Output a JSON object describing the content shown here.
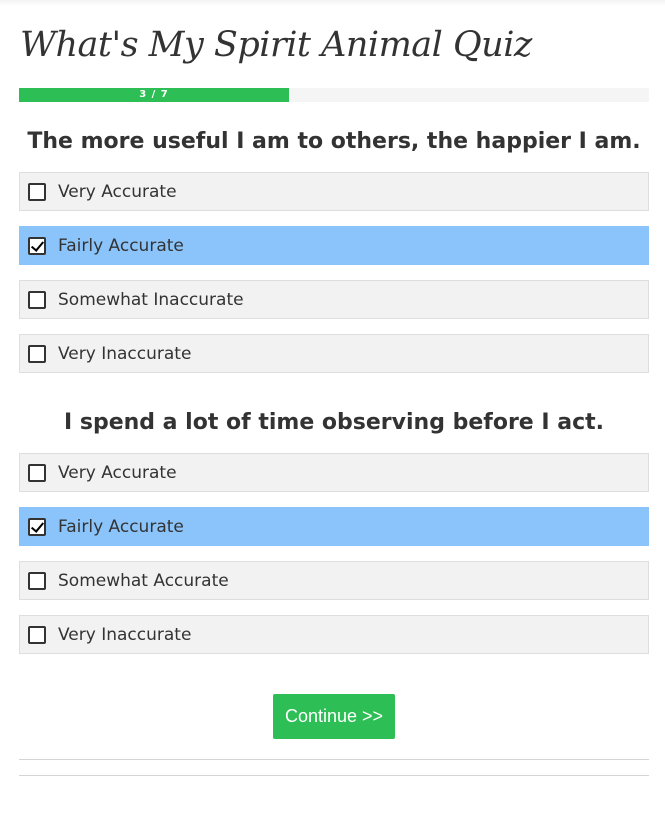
{
  "quiz": {
    "title": "What's My Spirit Animal Quiz",
    "progress": {
      "label": "3 / 7",
      "current": 3,
      "total": 7,
      "fraction": 0.4286,
      "color": "#2dbe55"
    },
    "questions": [
      {
        "text": "The more useful I am to others, the happier I am.",
        "options": [
          {
            "label": "Very Accurate",
            "selected": false
          },
          {
            "label": "Fairly Accurate",
            "selected": true
          },
          {
            "label": "Somewhat Inaccurate",
            "selected": false
          },
          {
            "label": "Very Inaccurate",
            "selected": false
          }
        ]
      },
      {
        "text": "I spend a lot of time observing before I act.",
        "options": [
          {
            "label": "Very Accurate",
            "selected": false
          },
          {
            "label": "Fairly Accurate",
            "selected": true
          },
          {
            "label": "Somewhat Accurate",
            "selected": false
          },
          {
            "label": "Very Inaccurate",
            "selected": false
          }
        ]
      }
    ],
    "continue_label": "Continue >>",
    "colors": {
      "accent": "#2dbe55",
      "selected_option": "#8ac4fb",
      "option_bg": "#f2f2f2"
    }
  }
}
